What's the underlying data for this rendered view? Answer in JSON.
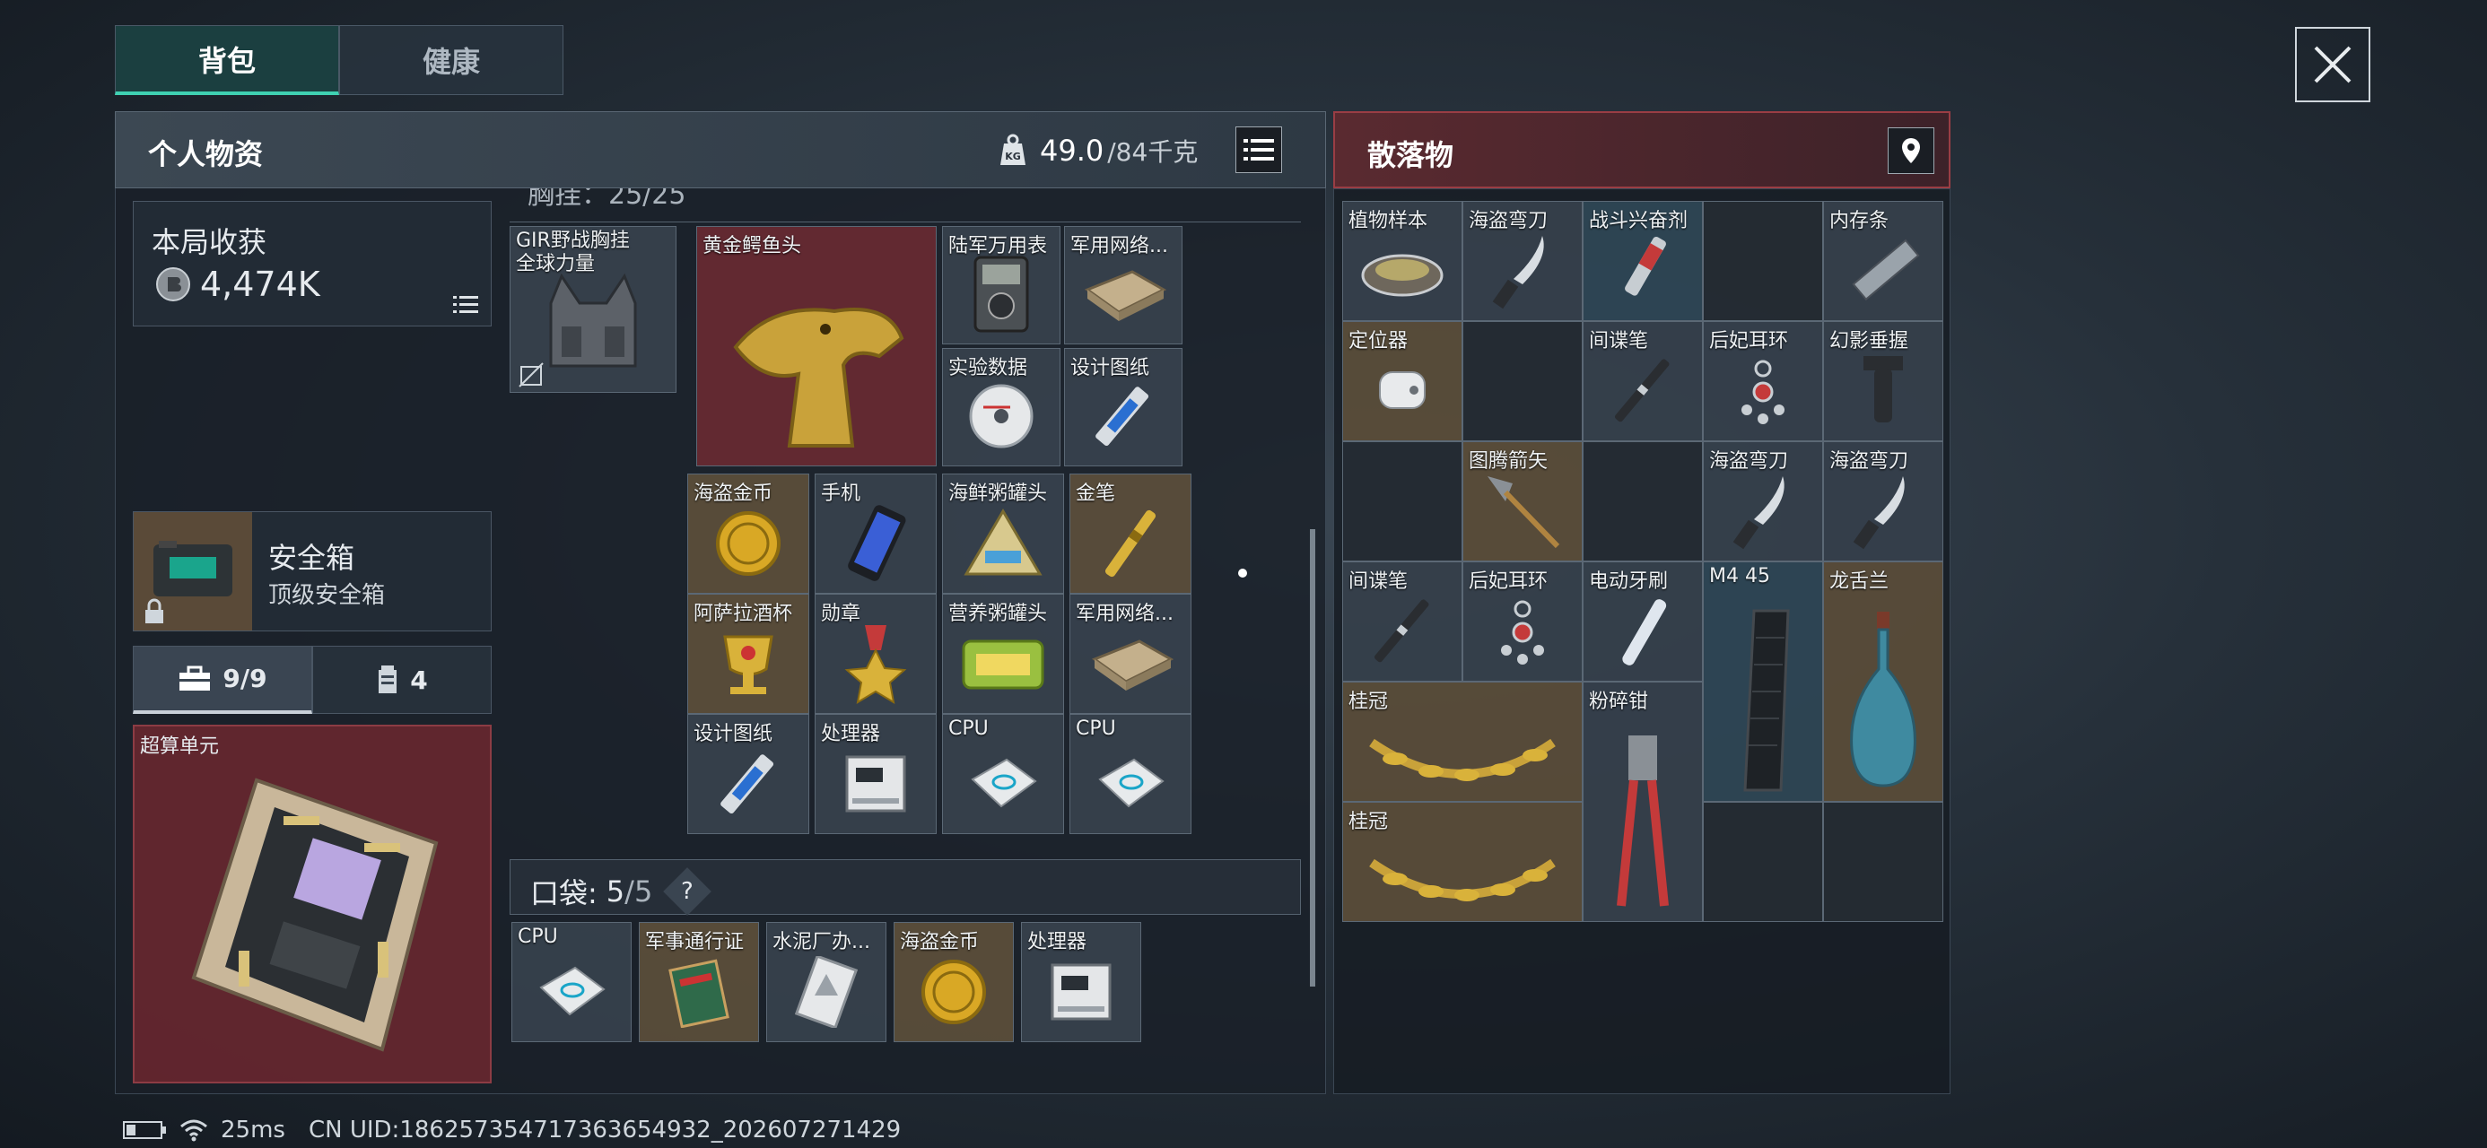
{
  "tabs": {
    "backpack": "背包",
    "health": "健康"
  },
  "left_panel": {
    "title": "个人物资",
    "weight_value": "49.0",
    "weight_max": "/84千克",
    "weight_badge": "KG"
  },
  "right_panel": {
    "title": "散落物"
  },
  "harvest": {
    "label": "本局收获",
    "value": "4,474K"
  },
  "safe_box": {
    "title": "安全箱",
    "subtitle": "顶级安全箱"
  },
  "count_tabs": {
    "kit": "9/9",
    "other": "4"
  },
  "secure_slot": {
    "label": "超算单元"
  },
  "rig_header": "胸挂：25/25",
  "equipped": {
    "vest": "GIR野战胸挂\n全球力量"
  },
  "backpack_items": [
    {
      "label": "黄金鳄鱼头"
    },
    {
      "label": "陆军万用表"
    },
    {
      "label": "军用网络..."
    },
    {
      "label": "实验数据"
    },
    {
      "label": "设计图纸"
    },
    {
      "label": "海盗金币"
    },
    {
      "label": "手机"
    },
    {
      "label": "海鲜粥罐头"
    },
    {
      "label": "金笔"
    },
    {
      "label": "阿萨拉酒杯"
    },
    {
      "label": "勋章"
    },
    {
      "label": "营养粥罐头"
    },
    {
      "label": "军用网络..."
    },
    {
      "label": "设计图纸"
    },
    {
      "label": "处理器"
    },
    {
      "label": "CPU"
    },
    {
      "label": "CPU"
    }
  ],
  "pocket": {
    "label": "口袋:",
    "count": "5",
    "max": "/5",
    "help": "?",
    "items": [
      {
        "label": "CPU"
      },
      {
        "label": "军事通行证"
      },
      {
        "label": "水泥厂办..."
      },
      {
        "label": "海盗金币"
      },
      {
        "label": "处理器"
      }
    ]
  },
  "loot_items": [
    {
      "label": "植物样本"
    },
    {
      "label": "海盗弯刀"
    },
    {
      "label": "战斗兴奋剂"
    },
    {
      "label": "内存条"
    },
    {
      "label": "定位器"
    },
    {
      "label": "间谍笔"
    },
    {
      "label": "后妃耳环"
    },
    {
      "label": "幻影垂握"
    },
    {
      "label": "图腾箭矢"
    },
    {
      "label": "海盗弯刀"
    },
    {
      "label": "海盗弯刀"
    },
    {
      "label": "间谍笔"
    },
    {
      "label": "后妃耳环"
    },
    {
      "label": "电动牙刷"
    },
    {
      "label": "M4 45"
    },
    {
      "label": "龙舌兰"
    },
    {
      "label": "桂冠"
    },
    {
      "label": "粉碎钳"
    },
    {
      "label": "桂冠"
    }
  ],
  "status": {
    "ping": "25ms",
    "uid": "CN UID:18625735471736365493​2_202607271429"
  },
  "colors": {
    "accent_teal": "#3fd1b2",
    "loot_red": "#9a3d44",
    "gold_slot": "#62523c"
  }
}
